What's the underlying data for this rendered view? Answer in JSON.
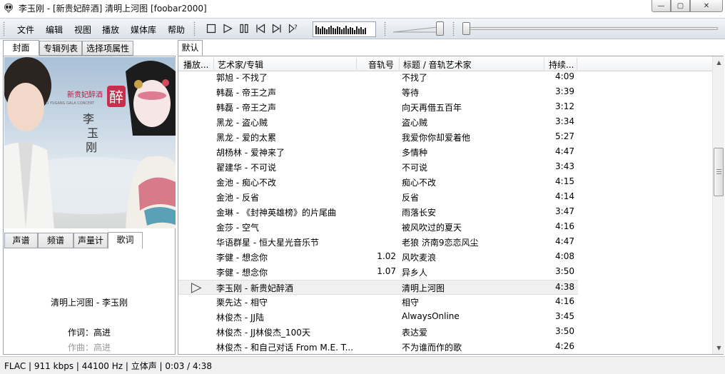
{
  "window": {
    "title": "李玉刚 - [新贵妃醉酒] 清明上河图  [foobar2000]",
    "buttons": {
      "minimize": "—",
      "maximize": "▢",
      "close": "✕"
    }
  },
  "menu": [
    "文件",
    "编辑",
    "视图",
    "播放",
    "媒体库",
    "帮助"
  ],
  "transport_icons": [
    "stop-icon",
    "play-icon",
    "pause-icon",
    "previous-icon",
    "next-icon",
    "random-icon"
  ],
  "volume_level": 0.9,
  "seek_position": 0.01,
  "left_tabs": {
    "top": [
      "封面",
      "专辑列表",
      "选择项属性"
    ],
    "top_active": 0,
    "bottom": [
      "声谱",
      "频谱",
      "声量计",
      "歌词"
    ],
    "bottom_active": 3
  },
  "cover": {
    "english_line": "LI YUGANG GALA CONCERT",
    "album_cn": "新贵妃醉酒",
    "seal_char": "醉",
    "artist_vertical": [
      "李",
      "玉",
      "刚"
    ]
  },
  "lyrics": {
    "title_line": "清明上河图 - 李玉刚",
    "lines": [
      "作词：高进",
      "作曲：高进"
    ]
  },
  "playlist": {
    "tab": "默认",
    "columns": [
      "播放...",
      "艺术家/专辑",
      "音轨号",
      "标题 / 音轨艺术家",
      "持续..."
    ],
    "rows": [
      {
        "artist_album": "郭旭 - 不找了",
        "track": "",
        "title": "不找了",
        "duration": "4:09"
      },
      {
        "artist_album": "韩磊 - 帝王之声",
        "track": "",
        "title": "等待",
        "duration": "3:39"
      },
      {
        "artist_album": "韩磊 - 帝王之声",
        "track": "",
        "title": "向天再借五百年",
        "duration": "3:12"
      },
      {
        "artist_album": "黑龙 - 盗心贼",
        "track": "",
        "title": "盗心贼",
        "duration": "3:34"
      },
      {
        "artist_album": "黑龙 - 爱的太累",
        "track": "",
        "title": "我爱你你却爱着他",
        "duration": "5:27"
      },
      {
        "artist_album": "胡杨林 - 爱神来了",
        "track": "",
        "title": "多情种",
        "duration": "4:47"
      },
      {
        "artist_album": "翟建华 - 不可说",
        "track": "",
        "title": "不可说",
        "duration": "3:43"
      },
      {
        "artist_album": "金池 - 痴心不改",
        "track": "",
        "title": "痴心不改",
        "duration": "4:15"
      },
      {
        "artist_album": "金池 - 反省",
        "track": "",
        "title": "反省",
        "duration": "4:14"
      },
      {
        "artist_album": "金琳 - 《封神英雄榜》的片尾曲",
        "track": "",
        "title": "雨落长安",
        "duration": "3:47"
      },
      {
        "artist_album": "金莎 - 空气",
        "track": "",
        "title": "被风吹过的夏天",
        "duration": "4:16"
      },
      {
        "artist_album": "华语群星 - 恒大星光音乐节",
        "track": "",
        "title": "老狼 济南9恋恋风尘",
        "duration": "4:47"
      },
      {
        "artist_album": "李健 - 想念你",
        "track": "1.02",
        "title": "风吹麦浪",
        "duration": "4:08"
      },
      {
        "artist_album": "李健 - 想念你",
        "track": "1.07",
        "title": "异乡人",
        "duration": "3:50"
      },
      {
        "artist_album": "李玉刚 - 新贵妃醉酒",
        "track": "",
        "title": "清明上河图",
        "duration": "4:38",
        "playing": true
      },
      {
        "artist_album": "栗先达 - 相守",
        "track": "",
        "title": "相守",
        "duration": "4:16"
      },
      {
        "artist_album": "林俊杰 - JJ陆",
        "track": "",
        "title": "AlwaysOnline",
        "duration": "3:45"
      },
      {
        "artist_album": "林俊杰 - JJ林俊杰_100天",
        "track": "",
        "title": "表达爱",
        "duration": "3:50"
      },
      {
        "artist_album": "林俊杰 - 和自己对话 From M.E. T...",
        "track": "",
        "title": "不为谁而作的歌",
        "duration": "4:26"
      }
    ]
  },
  "status": "FLAC | 911 kbps | 44100 Hz | 立体声 | 0:03 / 4:38"
}
